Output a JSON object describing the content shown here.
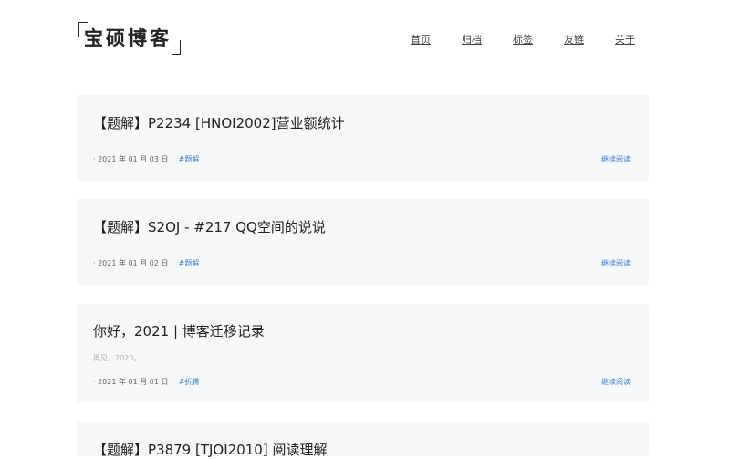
{
  "site": {
    "logo_text": "宝硕博客"
  },
  "nav": {
    "items": [
      {
        "label": "首页"
      },
      {
        "label": "归档"
      },
      {
        "label": "标签"
      },
      {
        "label": "友链"
      },
      {
        "label": "关于"
      }
    ]
  },
  "posts": [
    {
      "title": "【题解】P2234 [HNOI2002]营业额统计",
      "excerpt": "",
      "date": "· 2021 年 01 月 03 日 ·",
      "tag": "#题解",
      "read_more": "继续阅读"
    },
    {
      "title": "【题解】S2OJ - #217 QQ空间的说说",
      "excerpt": "",
      "date": "· 2021 年 01 月 02 日 ·",
      "tag": "#题解",
      "read_more": "继续阅读"
    },
    {
      "title": "你好，2021 | 博客迁移记录",
      "excerpt": "再见，2020。",
      "date": "· 2021 年 01 月 01 日 ·",
      "tag": "#折腾",
      "read_more": "继续阅读"
    },
    {
      "title": "【题解】P3879 [TJOI2010] 阅读理解",
      "excerpt": "",
      "date": "",
      "tag": "",
      "read_more": ""
    }
  ],
  "colors": {
    "accent": "#3a7bd5",
    "card_bg": "#f6f7f9"
  }
}
